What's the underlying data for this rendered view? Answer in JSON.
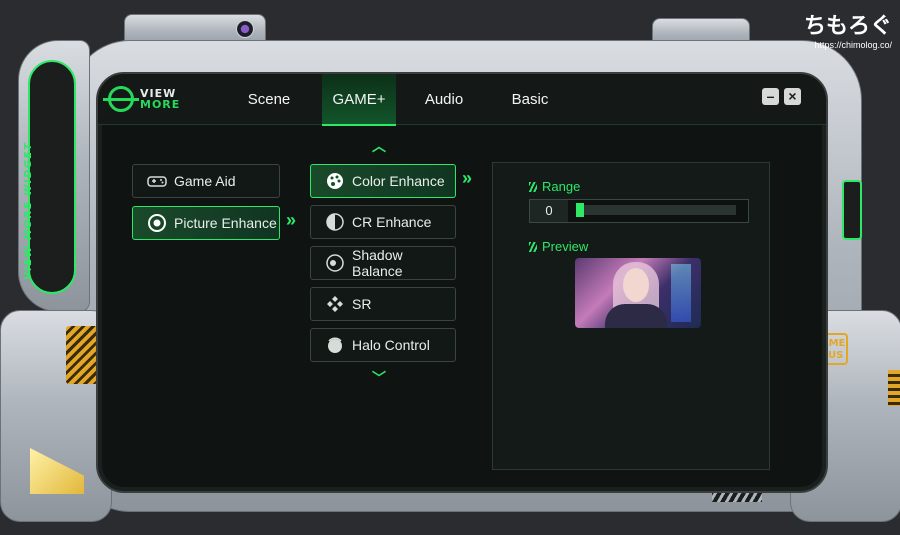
{
  "watermark": {
    "title": "ちもろぐ",
    "url": "https://chimolog.co/"
  },
  "side_label": "VIEW MORE WIDGET",
  "gameplus_badge": "GAME PLUS",
  "logo": {
    "line1": "VIEW",
    "line2": "MORE"
  },
  "tabs": [
    {
      "label": "Scene",
      "active": false
    },
    {
      "label": "GAME+",
      "active": true
    },
    {
      "label": "Audio",
      "active": false
    },
    {
      "label": "Basic",
      "active": false
    }
  ],
  "window_controls": {
    "minimize": "–",
    "close": "×"
  },
  "left_menu": [
    {
      "label": "Game Aid",
      "icon": "gamepad-icon",
      "active": false
    },
    {
      "label": "Picture Enhance",
      "icon": "picture-icon",
      "active": true
    }
  ],
  "sub_menu": [
    {
      "label": "Color Enhance",
      "icon": "palette-icon",
      "active": true
    },
    {
      "label": "CR Enhance",
      "icon": "contrast-icon",
      "active": false
    },
    {
      "label": "Shadow Balance",
      "icon": "shadow-icon",
      "active": false
    },
    {
      "label": "SR",
      "icon": "sr-icon",
      "active": false
    },
    {
      "label": "Halo Control",
      "icon": "halo-icon",
      "active": false
    }
  ],
  "detail": {
    "range_label": "Range",
    "range_value": "0",
    "range_fraction": 0,
    "preview_label": "Preview"
  },
  "colors": {
    "accent": "#2ee868",
    "gold": "#e2a726"
  }
}
